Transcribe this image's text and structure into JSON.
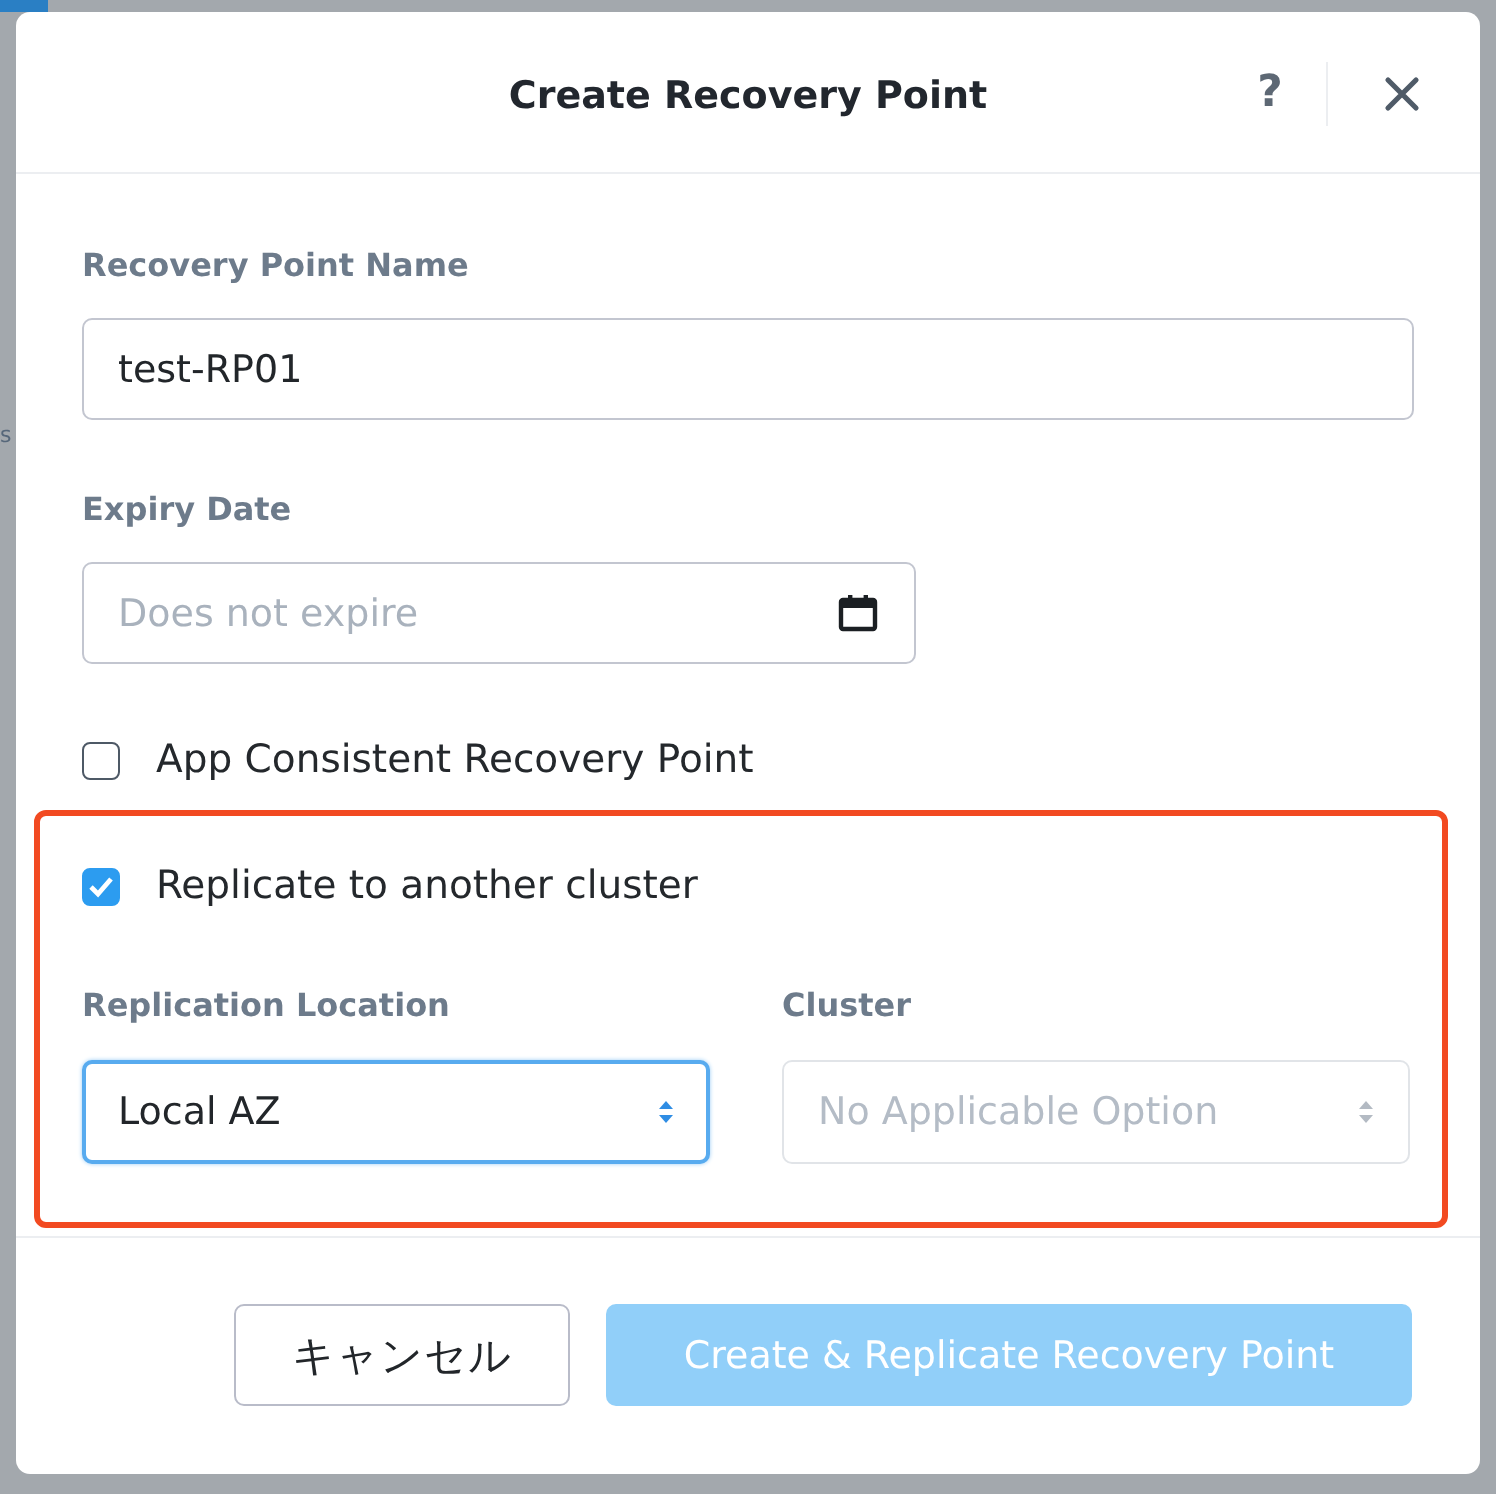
{
  "backdrop": {
    "fragment": "s"
  },
  "window": {
    "title": "Create Recovery Point",
    "help": "?"
  },
  "form": {
    "name_field": {
      "label": "Recovery Point Name",
      "value": "test-RP01"
    },
    "expiry_field": {
      "label": "Expiry Date",
      "placeholder": "Does not expire"
    },
    "app_consistent": {
      "label": "App Consistent Recovery Point",
      "checked": false
    }
  },
  "replication": {
    "highlighted": true,
    "replicate": {
      "label": "Replicate to another cluster",
      "checked": true
    },
    "fields": [
      {
        "label": "Replication Location",
        "value": "Local AZ",
        "focused": true,
        "disabled": false
      },
      {
        "label": "Cluster",
        "value": "No Applicable Option",
        "focused": false,
        "disabled": true
      }
    ]
  },
  "buttons": [
    {
      "kind": "secondary",
      "label": "キャンセル",
      "disabled": false
    },
    {
      "kind": "primary",
      "label": "Create & Replicate Recovery Point",
      "disabled": true
    }
  ]
}
